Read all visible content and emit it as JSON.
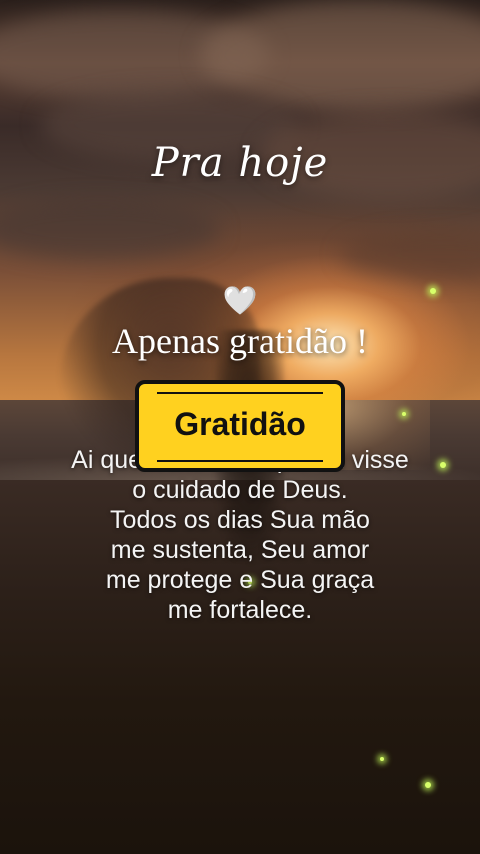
{
  "title": "Pra hoje",
  "heart_icon": "white-heart-icon",
  "heart_glyph": "🤍",
  "subtitle": "Apenas gratidão !",
  "badge": {
    "label": "Gratidão",
    "color": "#ffd11f"
  },
  "body_lines": [
    "Ai quem me dera que eu visse",
    "o cuidado de Deus.",
    "Todos os dias Sua mão",
    "me sustenta, Seu amor",
    "me protege e Sua graça",
    "me fortalece."
  ]
}
